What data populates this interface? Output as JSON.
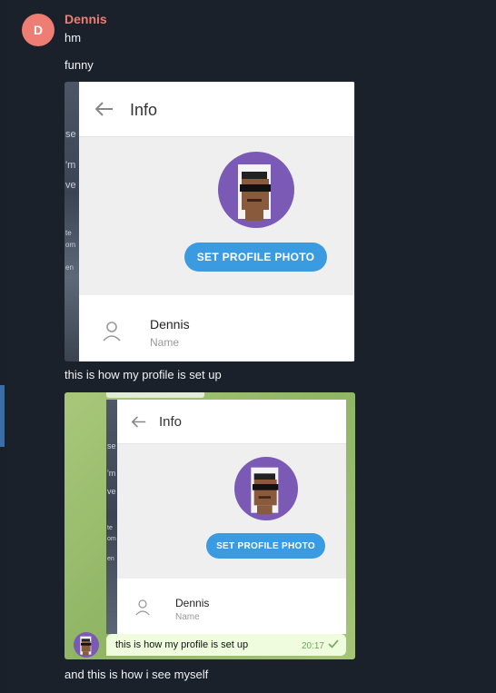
{
  "message": {
    "sender_initial": "D",
    "sender_name": "Dennis",
    "lines": [
      "hm",
      "funny"
    ],
    "caption_1": "this is how my profile is set up",
    "caption_2": "and this is how i see myself"
  },
  "screenshot_1": {
    "title": "Info",
    "button": "SET PROFILE PHOTO",
    "name_value": "Dennis",
    "name_label": "Name",
    "bg_fragments": [
      "se",
      "'m",
      "ve",
      "te",
      "om",
      "en"
    ]
  },
  "screenshot_2": {
    "title": "Info",
    "button": "SET PROFILE PHOTO",
    "name_value": "Dennis",
    "name_label": "Name",
    "bubble_text": "this is how my profile is set up",
    "bubble_time": "20:17",
    "bg_fragments": [
      "se",
      "'m",
      "ve",
      "te",
      "om",
      "en"
    ]
  },
  "colors": {
    "background": "#1b212b",
    "sender": "#ee7d74",
    "accent_button": "#3b9be0",
    "avatar_purple": "#7a5ab5"
  }
}
